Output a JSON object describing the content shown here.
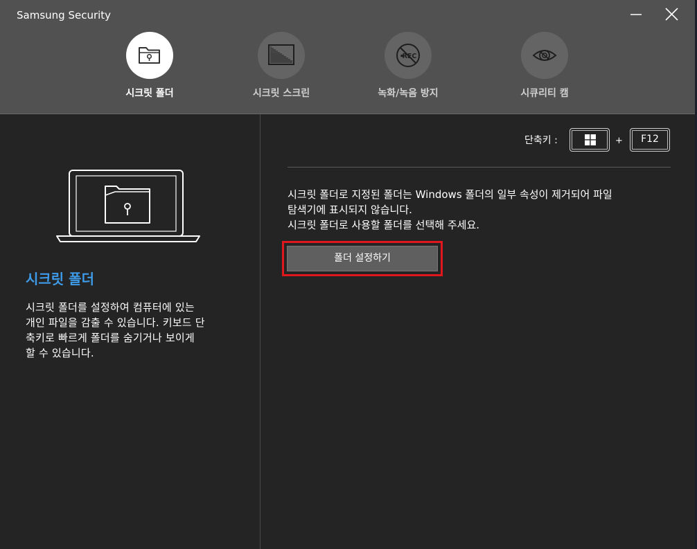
{
  "app": {
    "title": "Samsung Security"
  },
  "window_controls": {
    "minimize": "minimize-icon",
    "close": "close-icon"
  },
  "tabs": [
    {
      "label": "시크릿 폴더",
      "icon": "folder-lock-icon",
      "active": true
    },
    {
      "label": "시크릿 스크린",
      "icon": "screen-icon",
      "active": false
    },
    {
      "label": "녹화/녹음 방지",
      "icon": "no-rec-icon",
      "active": false
    },
    {
      "label": "시큐리티 캠",
      "icon": "eye-icon",
      "active": false
    }
  ],
  "left_panel": {
    "illustration": "laptop-folder-lock-icon",
    "title": "시크릿 폴더",
    "description": [
      "시크릿 폴더를 설정하여 컴퓨터에 있는",
      "개인 파일을 감출 수 있습니다. 키보드 단",
      "축키로 빠르게 폴더를 숨기거나 보이게",
      "할 수 있습니다."
    ]
  },
  "shortcut": {
    "label": "단축키 :",
    "key1": "windows-key-icon",
    "plus": "+",
    "key2": "F12"
  },
  "info": {
    "lines": [
      "시크릿 폴더로 지정된 폴더는 Windows 폴더의 일부 속성이 제거되어 파일",
      "탐색기에 표시되지 않습니다.",
      "시크릿 폴더로 사용할 폴더를 선택해 주세요."
    ]
  },
  "folder_button": {
    "label": "폴더 설정하기"
  },
  "colors": {
    "header_bg": "#515151",
    "body_bg": "#242424",
    "accent_blue": "#3d9be9",
    "highlight_red": "#e0181e",
    "button_bg": "#5f5f5f"
  }
}
